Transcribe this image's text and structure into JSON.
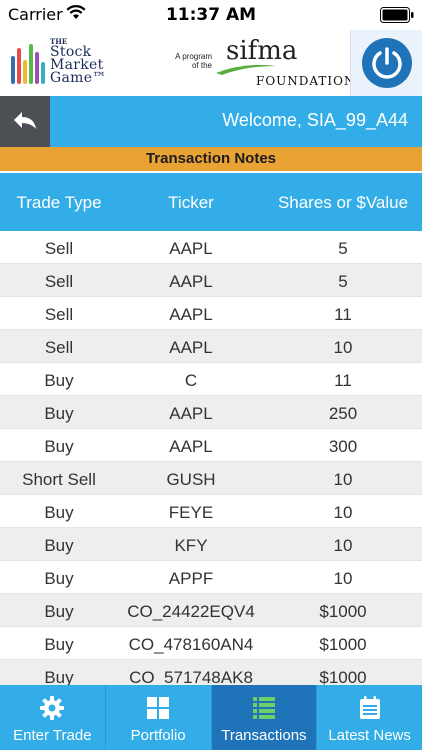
{
  "status_bar": {
    "carrier": "Carrier",
    "time": "11:37 AM"
  },
  "logos": {
    "smg": {
      "the": "THE",
      "line1": "Stock",
      "line2": "Market",
      "line3": "Game™"
    },
    "sifma": {
      "program_line1": "A program",
      "program_line2": "of the",
      "name": "sifma",
      "foundation": "FOUNDATION"
    }
  },
  "header": {
    "welcome": "Welcome, SIA_99_A44"
  },
  "section_title": "Transaction Notes",
  "table": {
    "columns": [
      "Trade Type",
      "Ticker",
      "Shares or $Value"
    ],
    "rows": [
      [
        "Sell",
        "AAPL",
        "5"
      ],
      [
        "Sell",
        "AAPL",
        "5"
      ],
      [
        "Sell",
        "AAPL",
        "11"
      ],
      [
        "Sell",
        "AAPL",
        "10"
      ],
      [
        "Buy",
        "C",
        "11"
      ],
      [
        "Buy",
        "AAPL",
        "250"
      ],
      [
        "Buy",
        "AAPL",
        "300"
      ],
      [
        "Short Sell",
        "GUSH",
        "10"
      ],
      [
        "Buy",
        "FEYE",
        "10"
      ],
      [
        "Buy",
        "KFY",
        "10"
      ],
      [
        "Buy",
        "APPF",
        "10"
      ],
      [
        "Buy",
        "CO_24422EQV4",
        "$1000"
      ],
      [
        "Buy",
        "CO_478160AN4",
        "$1000"
      ],
      [
        "Buy",
        "CO_571748AK8",
        "$1000"
      ]
    ]
  },
  "tabs": [
    {
      "label": "Enter Trade",
      "icon": "gear-icon",
      "active": false
    },
    {
      "label": "Portfolio",
      "icon": "grid-icon",
      "active": false
    },
    {
      "label": "Transactions",
      "icon": "list-icon",
      "active": true
    },
    {
      "label": "Latest News",
      "icon": "news-icon",
      "active": false
    }
  ],
  "colors": {
    "accent": "#32ade7",
    "active_tab": "#1f74b9",
    "section_bar": "#e9a234",
    "back_button": "#4c4f54"
  }
}
